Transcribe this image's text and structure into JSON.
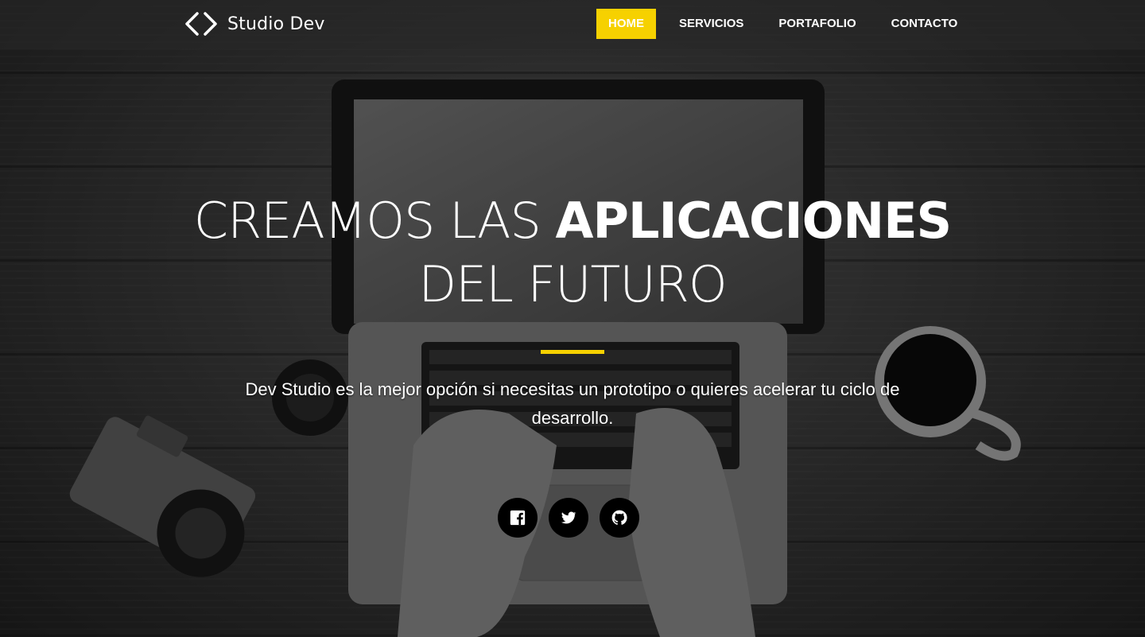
{
  "brand": {
    "name": "Studio Dev",
    "logo_icon": "code-brackets-icon"
  },
  "nav": {
    "items": [
      {
        "label": "HOME",
        "active": true
      },
      {
        "label": "SERVICIOS",
        "active": false
      },
      {
        "label": "PORTAFOLIO",
        "active": false
      },
      {
        "label": "CONTACTO",
        "active": false
      }
    ]
  },
  "hero": {
    "headline_light": "CREAMOS LAS ",
    "headline_bold": "APLICACIONES",
    "headline_line2": "DEL FUTURO",
    "subtitle": "Dev Studio es la mejor opción si necesitas un prototipo o quieres acelerar tu ciclo de desarrollo."
  },
  "social": [
    {
      "name": "facebook",
      "icon": "facebook-icon"
    },
    {
      "name": "twitter",
      "icon": "twitter-icon"
    },
    {
      "name": "github",
      "icon": "github-icon"
    }
  ],
  "colors": {
    "accent": "#f6d100",
    "nav_bg": "#282828",
    "social_bg": "#000000"
  }
}
